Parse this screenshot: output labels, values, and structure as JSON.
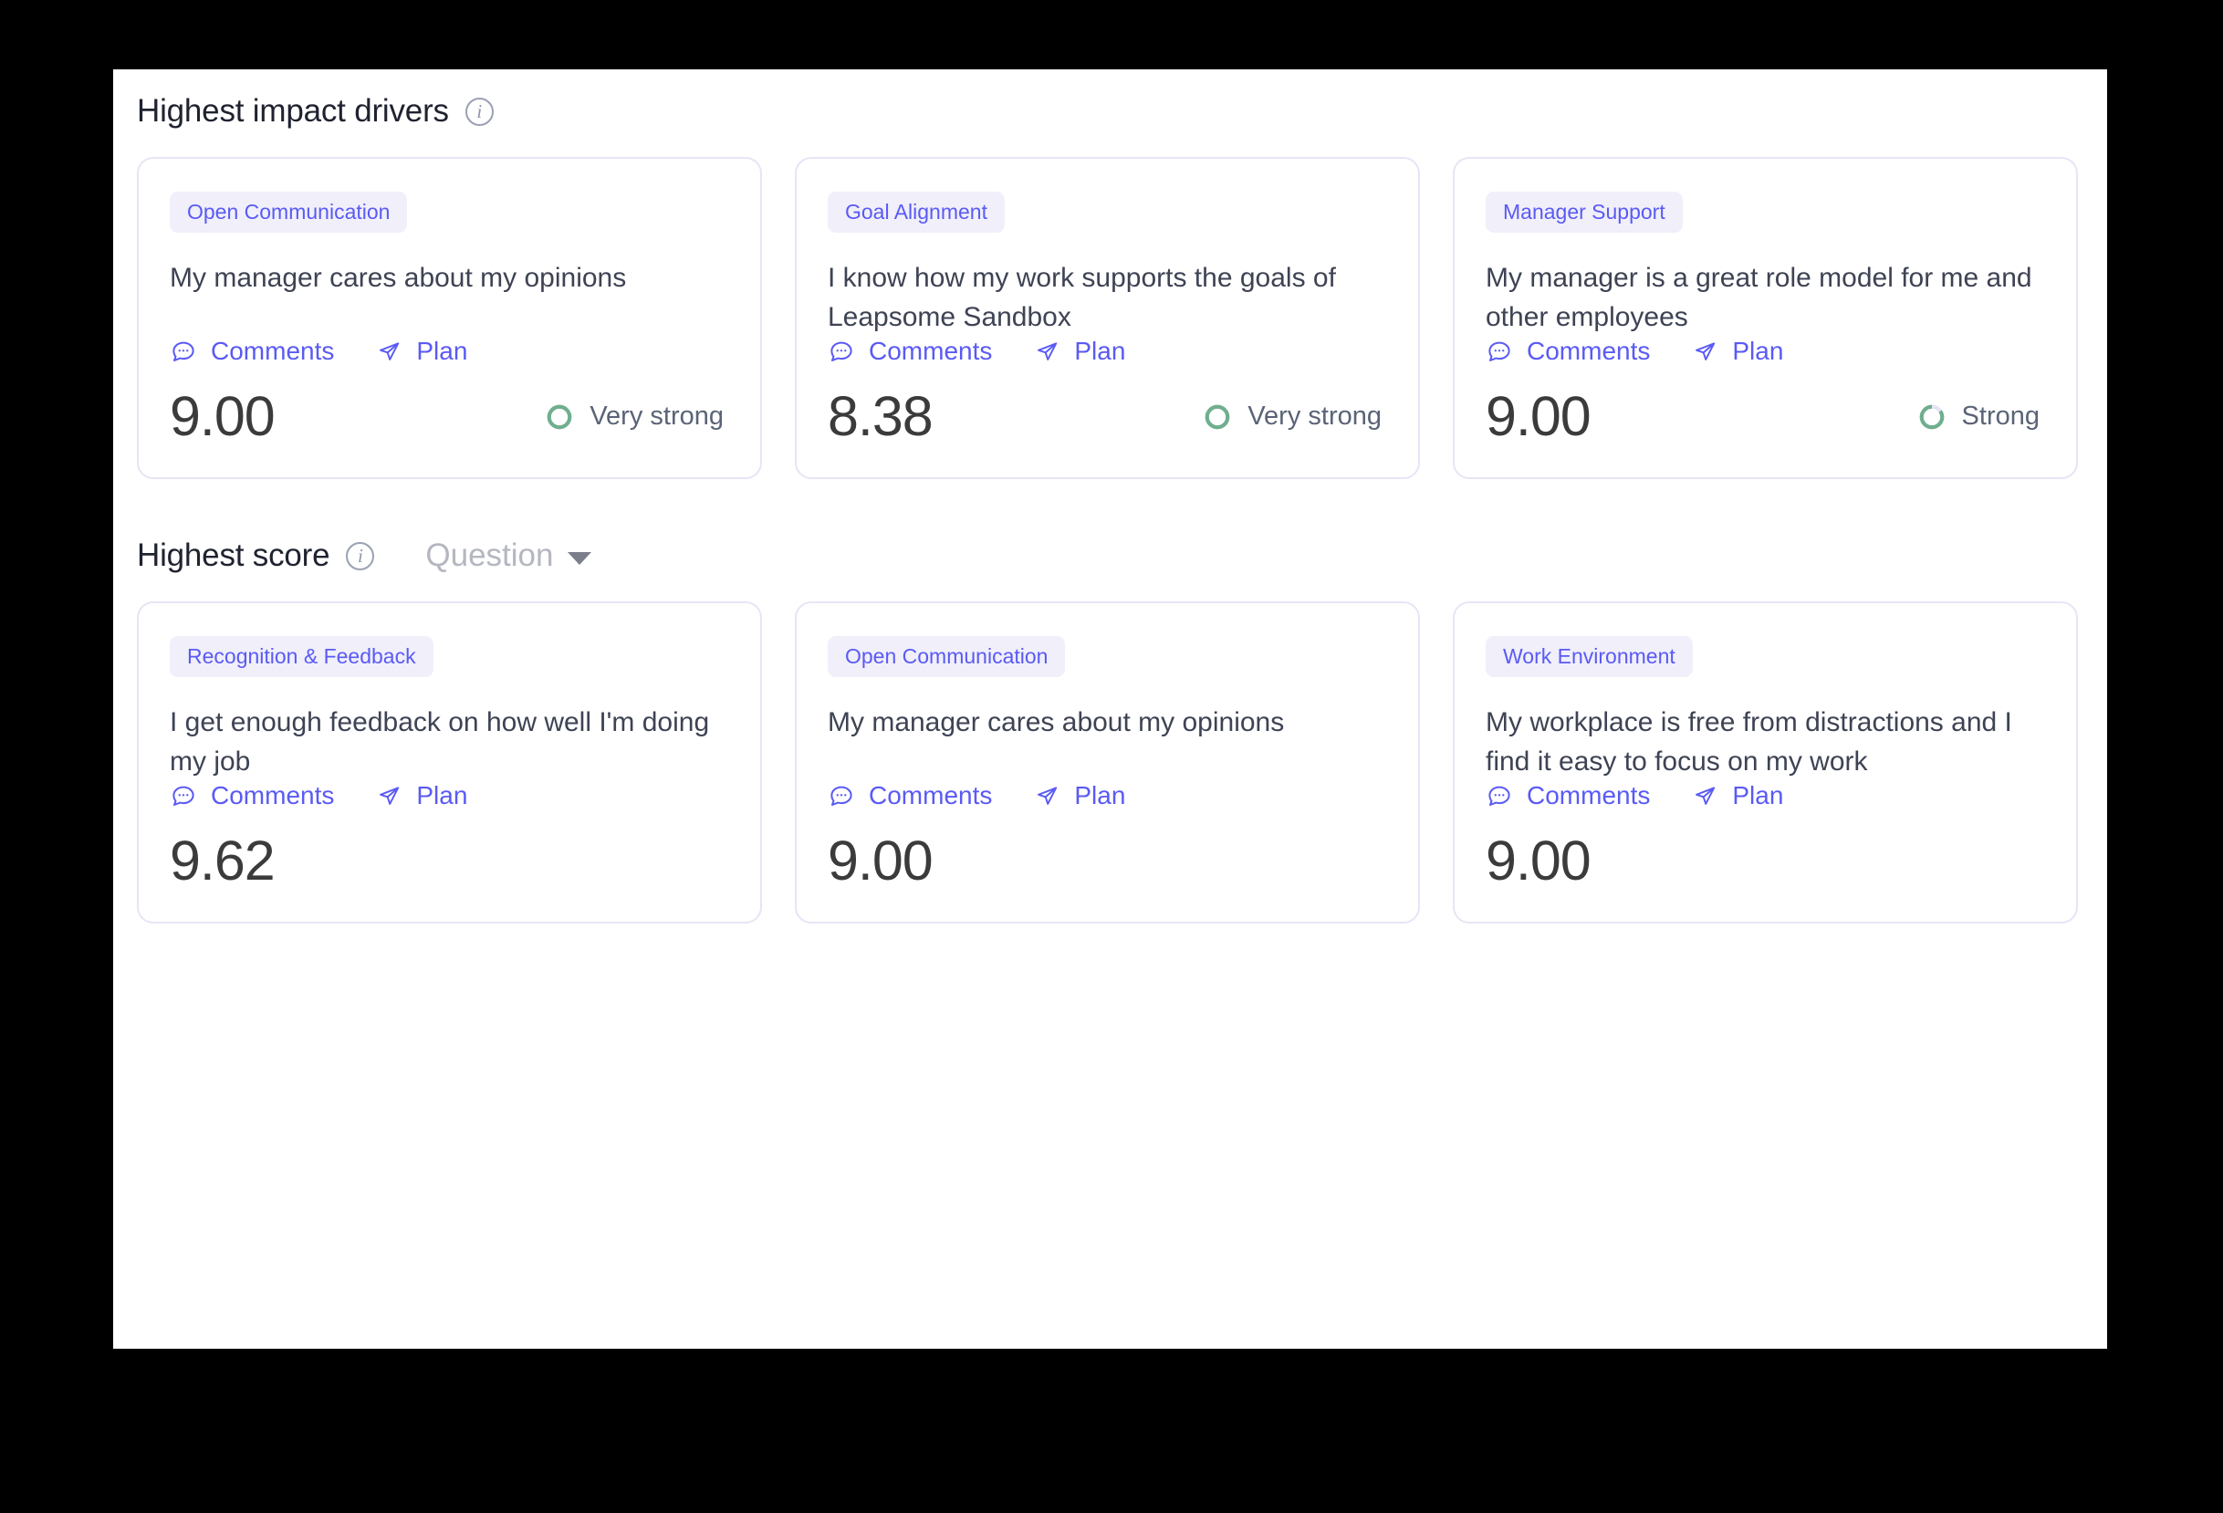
{
  "sections": [
    {
      "title": "Highest impact drivers",
      "info_icon": "info-icon",
      "cards": [
        {
          "tag": "Open Communication",
          "question": "My manager cares about my opinions",
          "comments_label": "Comments",
          "plan_label": "Plan",
          "score": "9.00",
          "strength": "Very strong",
          "strength_pct": 100
        },
        {
          "tag": "Goal Alignment",
          "question": "I know how my work supports the goals of Leapsome Sandbox",
          "comments_label": "Comments",
          "plan_label": "Plan",
          "score": "8.38",
          "strength": "Very strong",
          "strength_pct": 100
        },
        {
          "tag": "Manager Support",
          "question": "My manager is a great role model for me and other employees",
          "comments_label": "Comments",
          "plan_label": "Plan",
          "score": "9.00",
          "strength": "Strong",
          "strength_pct": 85
        }
      ]
    },
    {
      "title": "Highest score",
      "info_icon": "info-icon",
      "filter_label": "Question",
      "cards": [
        {
          "tag": "Recognition & Feedback",
          "question": "I get enough feedback on how well I'm doing my job",
          "comments_label": "Comments",
          "plan_label": "Plan",
          "score": "9.62",
          "strength": "",
          "strength_pct": 0
        },
        {
          "tag": "Open Communication",
          "question": "My manager cares about my opinions",
          "comments_label": "Comments",
          "plan_label": "Plan",
          "score": "9.00",
          "strength": "",
          "strength_pct": 0
        },
        {
          "tag": "Work Environment",
          "question": "My workplace is free from distractions and I find it easy to focus on my work",
          "comments_label": "Comments",
          "plan_label": "Plan",
          "score": "9.00",
          "strength": "",
          "strength_pct": 0
        }
      ]
    }
  ],
  "colors": {
    "accent": "#5a5af5",
    "tag_bg": "#f0effa",
    "card_border": "#e6e5f6",
    "ring_green": "#6fae8e",
    "ring_track": "#e4e2f4",
    "text_dark": "#3e4354",
    "score_text": "#3b3b3b",
    "muted": "#b4b7c0",
    "page_bg": "#ffffff",
    "backdrop": "#000000"
  },
  "icons": {
    "comments": "comment-bubble-icon",
    "plan": "paper-plane-icon",
    "info": "info-circle-icon",
    "caret": "chevron-down-icon"
  }
}
